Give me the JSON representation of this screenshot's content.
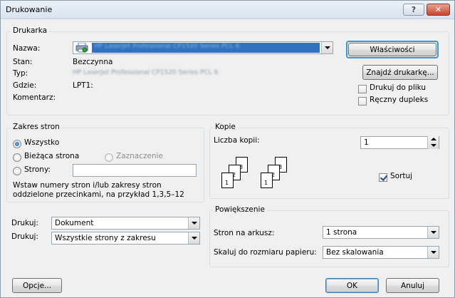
{
  "window": {
    "title": "Drukowanie",
    "help_glyph": "?",
    "close_glyph": "✕"
  },
  "printer": {
    "group_label": "Drukarka",
    "name_label": "Nazwa:",
    "name_value": "HP LaserJet Professional CP1520 Series PCL 6",
    "status_label": "Stan:",
    "status_value": "Bezczynna",
    "type_label": "Typ:",
    "type_value": "HP LaserJet Professional CP1520 Series PCL 6",
    "where_label": "Gdzie:",
    "where_value": "LPT1:",
    "comment_label": "Komentarz:",
    "properties_button": "Właściwości",
    "find_printer_button": "Znajdź drukarkę...",
    "print_to_file_label": "Drukuj do pliku",
    "print_to_file_checked": false,
    "manual_duplex_label": "Ręczny dupleks",
    "manual_duplex_checked": false
  },
  "page_range": {
    "group_label": "Zakres stron",
    "all_label": "Wszystko",
    "current_page_label": "Bieżąca strona",
    "selection_label": "Zaznaczenie",
    "pages_label": "Strony:",
    "pages_value": "",
    "selected": "all",
    "hint_line1": "Wstaw numery stron i/lub zakresy stron",
    "hint_line2": "oddzielone przecinkami, na przykład 1,3,5–12"
  },
  "copies": {
    "group_label": "Kopie",
    "count_label": "Liczba kopii:",
    "count_value": "1",
    "collate_label": "Sortuj",
    "collate_checked": true,
    "page_numbers": [
      "3",
      "2",
      "1",
      "3",
      "2",
      "1"
    ]
  },
  "print_what": {
    "label": "Drukuj:",
    "value": "Dokument"
  },
  "print_pages": {
    "label": "Drukuj:",
    "value": "Wszystkie strony z zakresu"
  },
  "zoom": {
    "group_label": "Powiększenie",
    "pages_per_sheet_label": "Stron na arkusz:",
    "pages_per_sheet_value": "1 strona",
    "scale_label": "Skaluj do rozmiaru papieru:",
    "scale_value": "Bez skalowania"
  },
  "footer": {
    "options_button": "Opcje...",
    "ok_button": "OK",
    "cancel_button": "Anuluj"
  },
  "colors": {
    "accent": "#3399dd",
    "selection": "#3072c0"
  }
}
